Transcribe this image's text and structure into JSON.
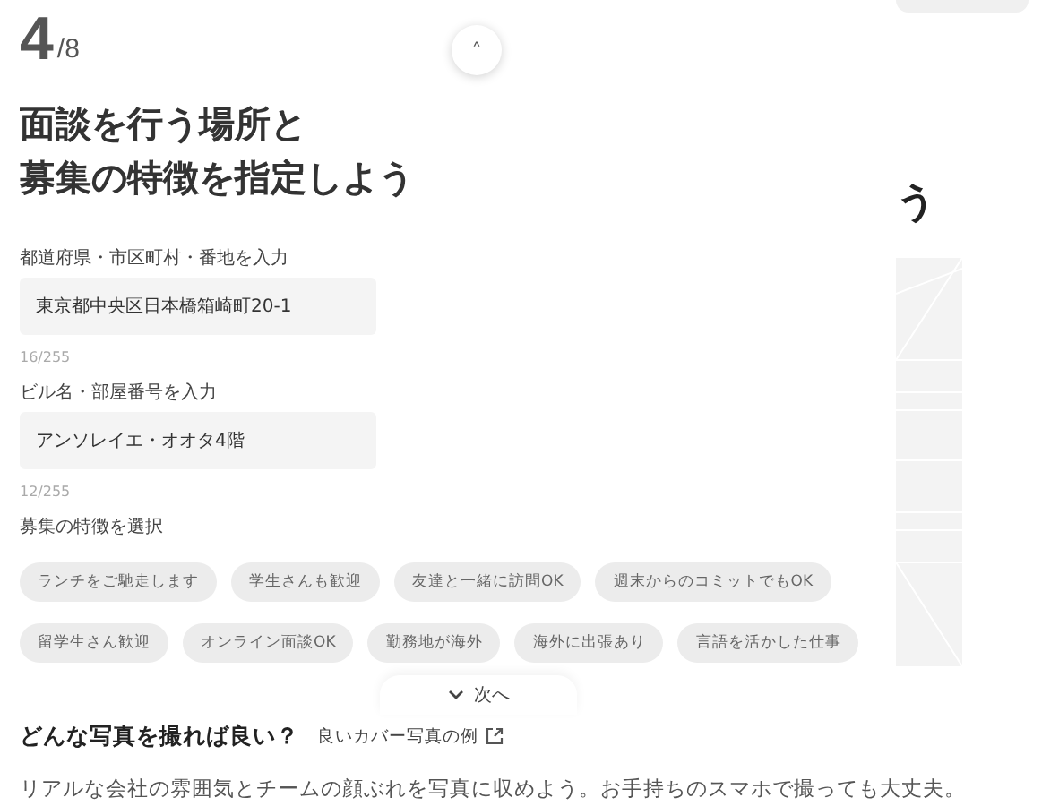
{
  "step": {
    "current": "4",
    "total": "/8"
  },
  "collapse_button": {
    "label": "˄"
  },
  "title": [
    "面談を行う場所と",
    "募集の特徴を指定しよう"
  ],
  "fields": [
    {
      "label": "都道府県・市区町村・番地を入力",
      "value": "東京都中央区日本橋箱崎町20-1",
      "count": "16/255"
    },
    {
      "label": "ビル名・部屋番号を入力",
      "value": "アンソレイエ・オオタ4階",
      "count": "12/255"
    }
  ],
  "features": {
    "label": "募集の特徴を選択",
    "chips": [
      {
        "label": "ランチをご馳走します",
        "selected": false
      },
      {
        "label": "学生さんも歓迎",
        "selected": false
      },
      {
        "label": "友達と一緒に訪問OK",
        "selected": false
      },
      {
        "label": "週末からのコミットでもOK",
        "selected": false
      },
      {
        "label": "留学生さん歓迎",
        "selected": false
      },
      {
        "label": "オンライン面談OK",
        "selected": false
      },
      {
        "label": "勤務地が海外",
        "selected": false
      },
      {
        "label": "海外に出張あり",
        "selected": false
      },
      {
        "label": "言語を活かした仕事",
        "selected": false
      }
    ]
  },
  "next_button": {
    "label": "次へ"
  },
  "background_heading": "う",
  "photo_help": {
    "heading": "どんな写真を撮れば良い？",
    "link": "良いカバー写真の例",
    "text": "リアルな会社の雰囲気とチームの顔ぶれを写真に収めよう。お手持ちのスマホで撮っても大丈夫。"
  }
}
